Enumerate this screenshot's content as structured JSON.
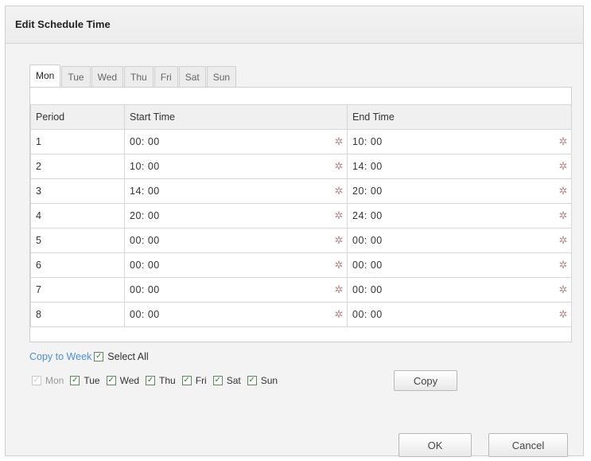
{
  "dialog": {
    "title": "Edit Schedule Time"
  },
  "tabs": [
    {
      "label": "Mon",
      "active": true
    },
    {
      "label": "Tue",
      "active": false
    },
    {
      "label": "Wed",
      "active": false
    },
    {
      "label": "Thu",
      "active": false
    },
    {
      "label": "Fri",
      "active": false
    },
    {
      "label": "Sat",
      "active": false
    },
    {
      "label": "Sun",
      "active": false
    }
  ],
  "table": {
    "headers": {
      "period": "Period",
      "start": "Start Time",
      "end": "End Time"
    },
    "rows": [
      {
        "period": "1",
        "start": "00: 00",
        "end": "10: 00"
      },
      {
        "period": "2",
        "start": "10: 00",
        "end": "14: 00"
      },
      {
        "period": "3",
        "start": "14: 00",
        "end": "20: 00"
      },
      {
        "period": "4",
        "start": "20: 00",
        "end": "24: 00"
      },
      {
        "period": "5",
        "start": "00: 00",
        "end": "00: 00"
      },
      {
        "period": "6",
        "start": "00: 00",
        "end": "00: 00"
      },
      {
        "period": "7",
        "start": "00: 00",
        "end": "00: 00"
      },
      {
        "period": "8",
        "start": "00: 00",
        "end": "00: 00"
      }
    ],
    "time_icon": "clock-icon"
  },
  "copy_week": {
    "link_label": "Copy to Week",
    "select_all_label": "Select All",
    "select_all_checked": true
  },
  "days": [
    {
      "label": "Mon",
      "checked": true,
      "disabled": true
    },
    {
      "label": "Tue",
      "checked": true,
      "disabled": false
    },
    {
      "label": "Wed",
      "checked": true,
      "disabled": false
    },
    {
      "label": "Thu",
      "checked": true,
      "disabled": false
    },
    {
      "label": "Fri",
      "checked": true,
      "disabled": false
    },
    {
      "label": "Sat",
      "checked": true,
      "disabled": false
    },
    {
      "label": "Sun",
      "checked": true,
      "disabled": false
    }
  ],
  "buttons": {
    "copy": "Copy",
    "ok": "OK",
    "cancel": "Cancel"
  },
  "colors": {
    "link": "#4a90d9",
    "check": "#2a7a2a"
  }
}
